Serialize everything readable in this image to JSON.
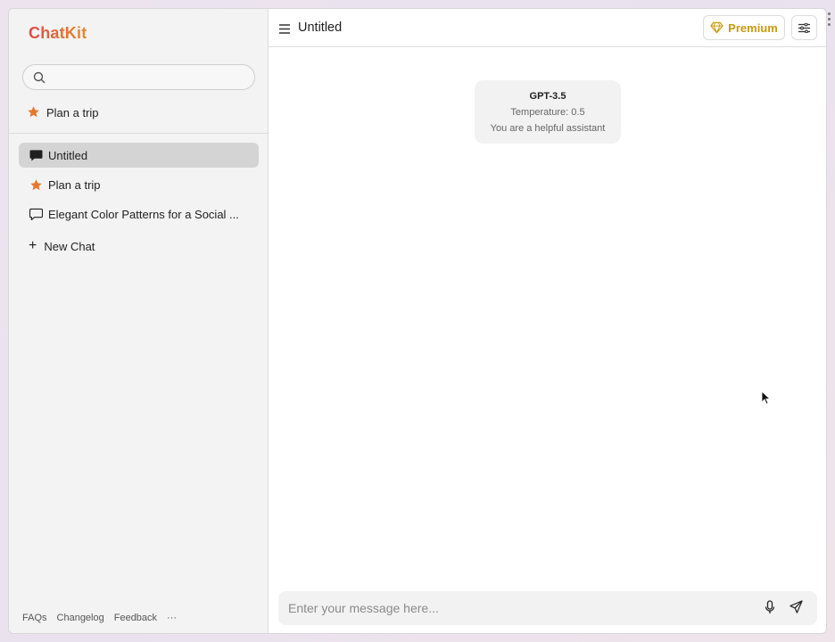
{
  "app": {
    "logo": "ChatKit"
  },
  "sidebar": {
    "search": {
      "placeholder": "",
      "value": ""
    },
    "pinned": [
      {
        "label": "Plan a trip",
        "icon": "star-icon"
      }
    ],
    "chats": [
      {
        "label": "Untitled",
        "icon": "chat-bubble-filled-icon",
        "active": true
      },
      {
        "label": "Plan a trip",
        "icon": "star-icon",
        "active": false
      },
      {
        "label": "Elegant Color Patterns for a Social ...",
        "icon": "chat-bubble-icon",
        "active": false
      }
    ],
    "new_chat_label": "New Chat",
    "footer": {
      "faqs": "FAQs",
      "changelog": "Changelog",
      "feedback": "Feedback",
      "more": "···"
    }
  },
  "header": {
    "title": "Untitled",
    "premium_label": "Premium"
  },
  "model_card": {
    "model": "GPT-3.5",
    "temperature": "Temperature: 0.5",
    "system": "You are a helpful assistant"
  },
  "composer": {
    "placeholder": "Enter your message here...",
    "value": ""
  },
  "colors": {
    "accent_star": "#e8762b",
    "premium": "#c99a10",
    "active_item": "#d4d4d4"
  }
}
